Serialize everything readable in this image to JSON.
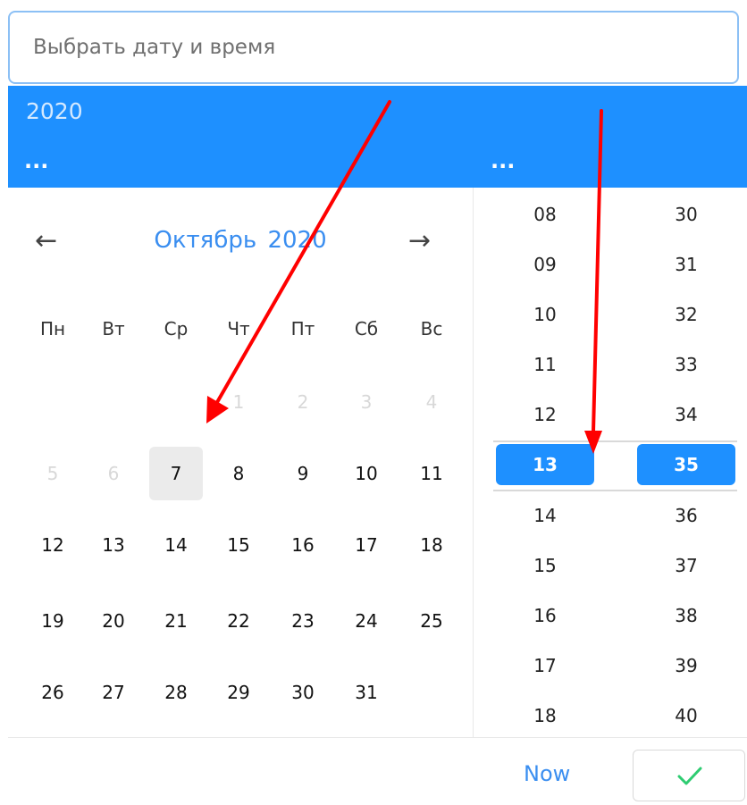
{
  "input": {
    "placeholder": "Выбрать дату и время"
  },
  "header": {
    "year": "2020",
    "date_dots": "...",
    "time_dots": "..."
  },
  "calendar": {
    "month": "Октябрь",
    "year": "2020",
    "weekdays": [
      "Пн",
      "Вт",
      "Ср",
      "Чт",
      "Пт",
      "Сб",
      "Вс"
    ],
    "weeks": [
      [
        "",
        "",
        "",
        "1",
        "2",
        "3",
        "4"
      ],
      [
        "5",
        "6",
        "7",
        "8",
        "9",
        "10",
        "11"
      ],
      [
        "12",
        "13",
        "14",
        "15",
        "16",
        "17",
        "18"
      ],
      [
        "19",
        "20",
        "21",
        "22",
        "23",
        "24",
        "25"
      ],
      [
        "26",
        "27",
        "28",
        "29",
        "30",
        "31",
        ""
      ]
    ],
    "faded_days": [
      "1",
      "2",
      "3",
      "4",
      "5",
      "6"
    ],
    "selected_day": "7"
  },
  "time": {
    "hours": [
      "08",
      "09",
      "10",
      "11",
      "12",
      "13",
      "14",
      "15",
      "16",
      "17",
      "18"
    ],
    "minutes": [
      "30",
      "31",
      "32",
      "33",
      "34",
      "35",
      "36",
      "37",
      "38",
      "39",
      "40"
    ],
    "selected_hour": "13",
    "selected_minute": "35"
  },
  "footer": {
    "now_label": "Now",
    "ok_icon": "checkmark-icon"
  },
  "colors": {
    "accent": "#1e90ff",
    "link": "#3a8ef0",
    "annotation": "#ff0000",
    "ok": "#2ecc71"
  }
}
